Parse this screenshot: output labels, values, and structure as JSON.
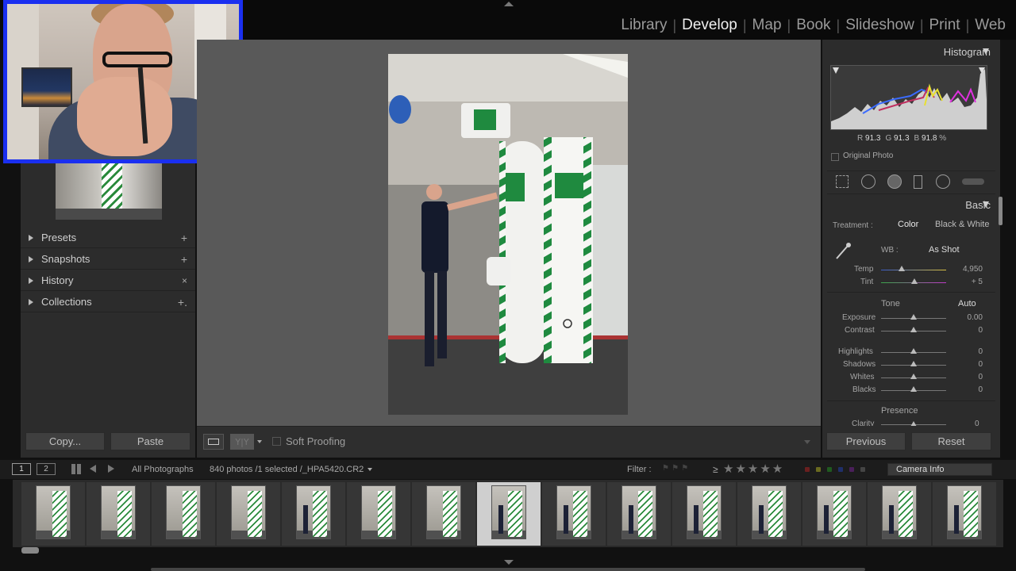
{
  "modules": [
    "Library",
    "Develop",
    "Map",
    "Book",
    "Slideshow",
    "Print",
    "Web"
  ],
  "active_module": "Develop",
  "left_panel": {
    "sections": [
      {
        "label": "Presets",
        "action": "+"
      },
      {
        "label": "Snapshots",
        "action": "+"
      },
      {
        "label": "History",
        "action": "×"
      },
      {
        "label": "Collections",
        "action": "+."
      }
    ],
    "copy_label": "Copy...",
    "paste_label": "Paste"
  },
  "toolbar": {
    "soft_proofing_label": "Soft Proofing",
    "compare_label": "Y|Y"
  },
  "right_panel": {
    "histogram_title": "Histogram",
    "rgb": {
      "r_label": "R",
      "r_value": "91.3",
      "g_label": "G",
      "g_value": "91.3",
      "b_label": "B",
      "b_value": "91.8",
      "unit": "%"
    },
    "original_photo_label": "Original Photo",
    "basic_title": "Basic",
    "treatment_label": "Treatment :",
    "treatment_color": "Color",
    "treatment_bw": "Black & White",
    "wb_label": "WB :",
    "wb_value": "As Shot",
    "temp_label": "Temp",
    "temp_value": "4,950",
    "tint_label": "Tint",
    "tint_value": "+ 5",
    "tone_label": "Tone",
    "auto_label": "Auto",
    "exposure_label": "Exposure",
    "exposure_value": "0.00",
    "contrast_label": "Contrast",
    "contrast_value": "0",
    "highlights_label": "Highlights",
    "highlights_value": "0",
    "shadows_label": "Shadows",
    "shadows_value": "0",
    "whites_label": "Whites",
    "whites_value": "0",
    "blacks_label": "Blacks",
    "blacks_value": "0",
    "presence_label": "Presence",
    "clarity_label": "Clarity",
    "clarity_value": "0",
    "previous_label": "Previous",
    "reset_label": "Reset"
  },
  "filmstrip_bar": {
    "page1": "1",
    "page2": "2",
    "source": "All Photographs",
    "count": "840 photos /1 selected /_HPA5420.CR2",
    "filter_label": "Filter :",
    "rating_op": "≥",
    "stars": "★★★★★",
    "camera_info": "Camera Info"
  },
  "filmstrip": {
    "thumb_count": 15,
    "selected_index": 7
  },
  "colors": {
    "accent_border": "#1a2ff0",
    "panel_bg": "#2c2c2c",
    "center_bg": "#595959",
    "selected_thumb": "#cfcfcf",
    "green_sign": "#2a8a3c"
  }
}
